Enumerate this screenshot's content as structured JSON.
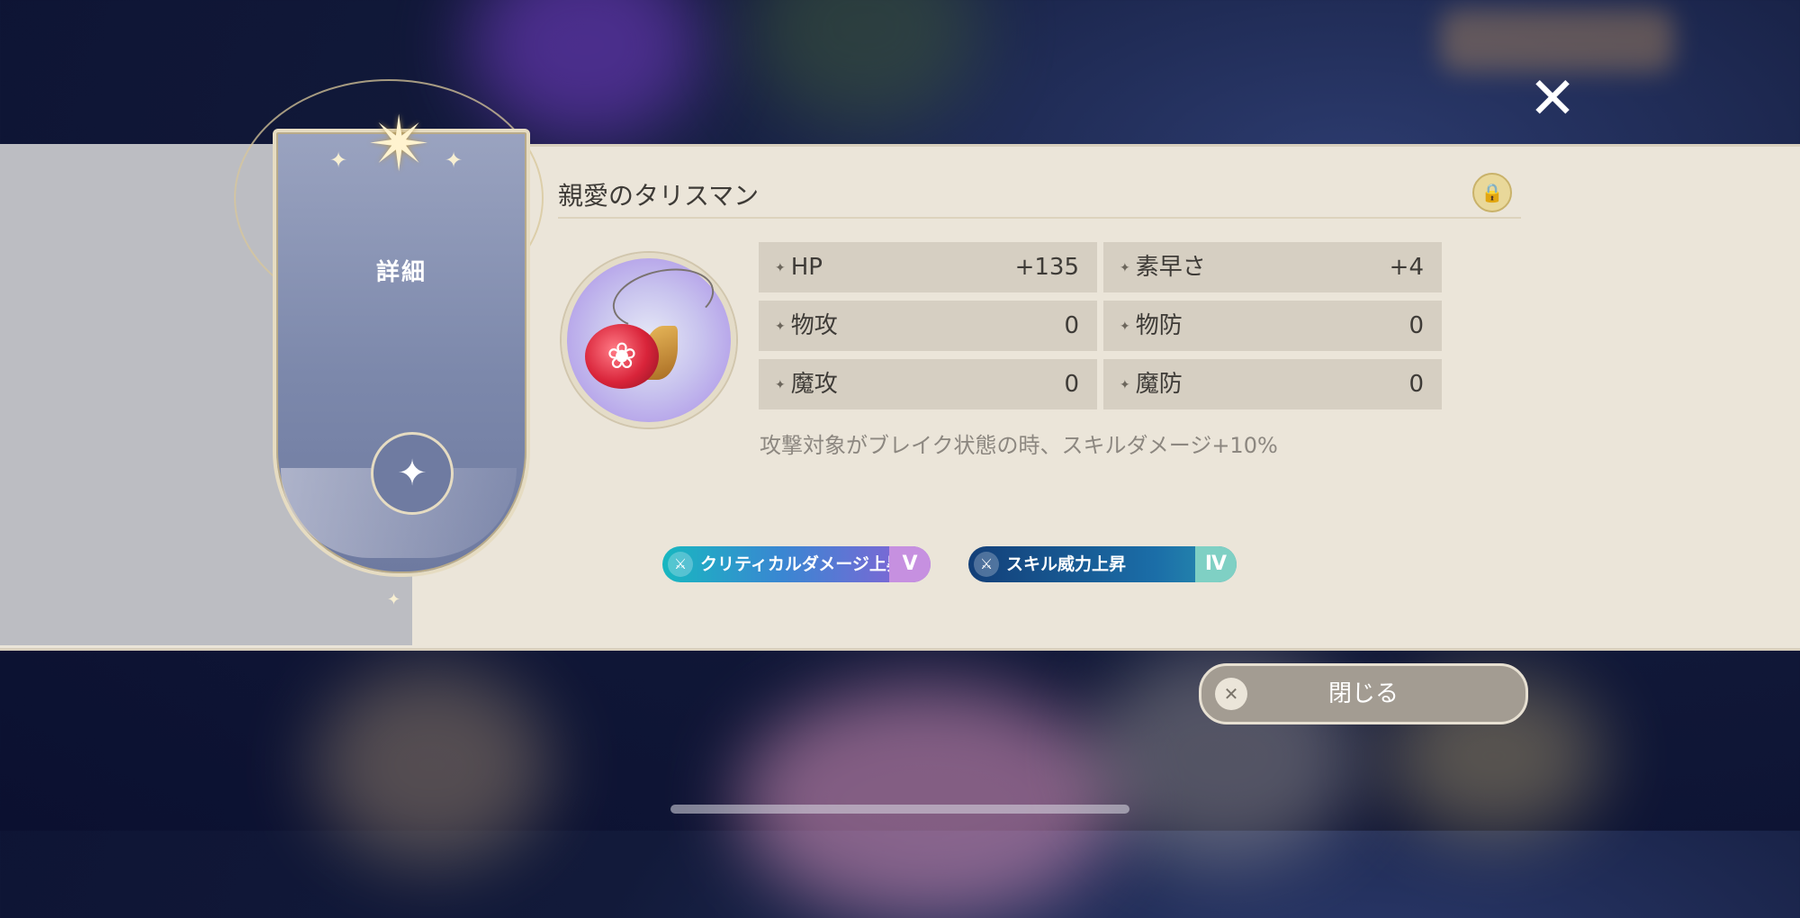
{
  "card": {
    "label": "詳細"
  },
  "item": {
    "name": "親愛のタリスマン",
    "description": "攻撃対象がブレイク状態の時、スキルダメージ+10%"
  },
  "stats": [
    {
      "label": "HP",
      "value": "+135"
    },
    {
      "label": "素早さ",
      "value": "+4"
    },
    {
      "label": "物攻",
      "value": "0"
    },
    {
      "label": "物防",
      "value": "0"
    },
    {
      "label": "魔攻",
      "value": "0"
    },
    {
      "label": "魔防",
      "value": "0"
    }
  ],
  "tags": [
    {
      "label": "クリティカルダメージ上昇",
      "level": "V"
    },
    {
      "label": "スキル威力上昇",
      "level": "Ⅳ"
    }
  ],
  "buttons": {
    "close_label": "閉じる"
  },
  "icons": {
    "close": "close-icon",
    "lock": "lock-icon",
    "star": "compass-star-icon",
    "talisman": "rose-pendant-icon",
    "tag": "sword-icon"
  },
  "colors": {
    "panel": "#ebe5d9",
    "stat_cell": "#d6cfc2",
    "tag1_start": "#18b7c0",
    "tag1_end": "#8e5fd6",
    "tag2_start": "#133f78",
    "tag2_end": "#2a93b0",
    "close_button": "#a39c92"
  }
}
